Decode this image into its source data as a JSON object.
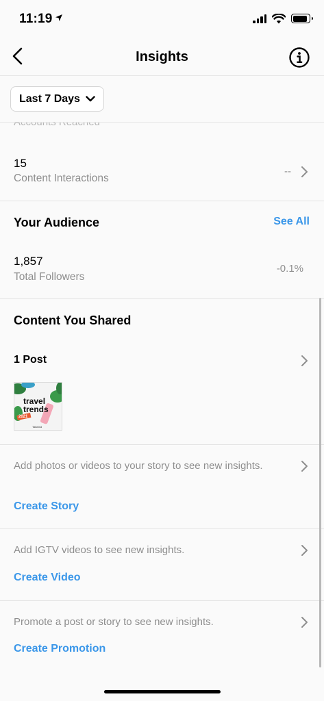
{
  "status_bar": {
    "time": "11:19"
  },
  "nav": {
    "title": "Insights"
  },
  "filter": {
    "label": "Last 7 Days"
  },
  "partial_row": {
    "label": "Accounts Reached"
  },
  "interactions": {
    "value": "15",
    "label": "Content Interactions",
    "change": "--"
  },
  "audience": {
    "title": "Your Audience",
    "see_all": "See All",
    "followers_value": "1,857",
    "followers_label": "Total Followers",
    "followers_change": "-0.1%"
  },
  "content": {
    "title": "Content You Shared",
    "posts_label": "1 Post",
    "thumbnail": {
      "line1": "travel",
      "line2": "trends",
      "tag": "2021",
      "credit": "Tailwind"
    }
  },
  "story": {
    "text": "Add photos or videos to your story to see new insights.",
    "action": "Create Story"
  },
  "igtv": {
    "text": "Add IGTV videos to see new insights.",
    "action": "Create Video"
  },
  "promotion": {
    "text": "Promote a post or story to see new insights.",
    "action": "Create Promotion"
  },
  "colors": {
    "link": "#3b97e9",
    "secondary_text": "#8e8e8e",
    "divider": "#e3e3e3"
  }
}
